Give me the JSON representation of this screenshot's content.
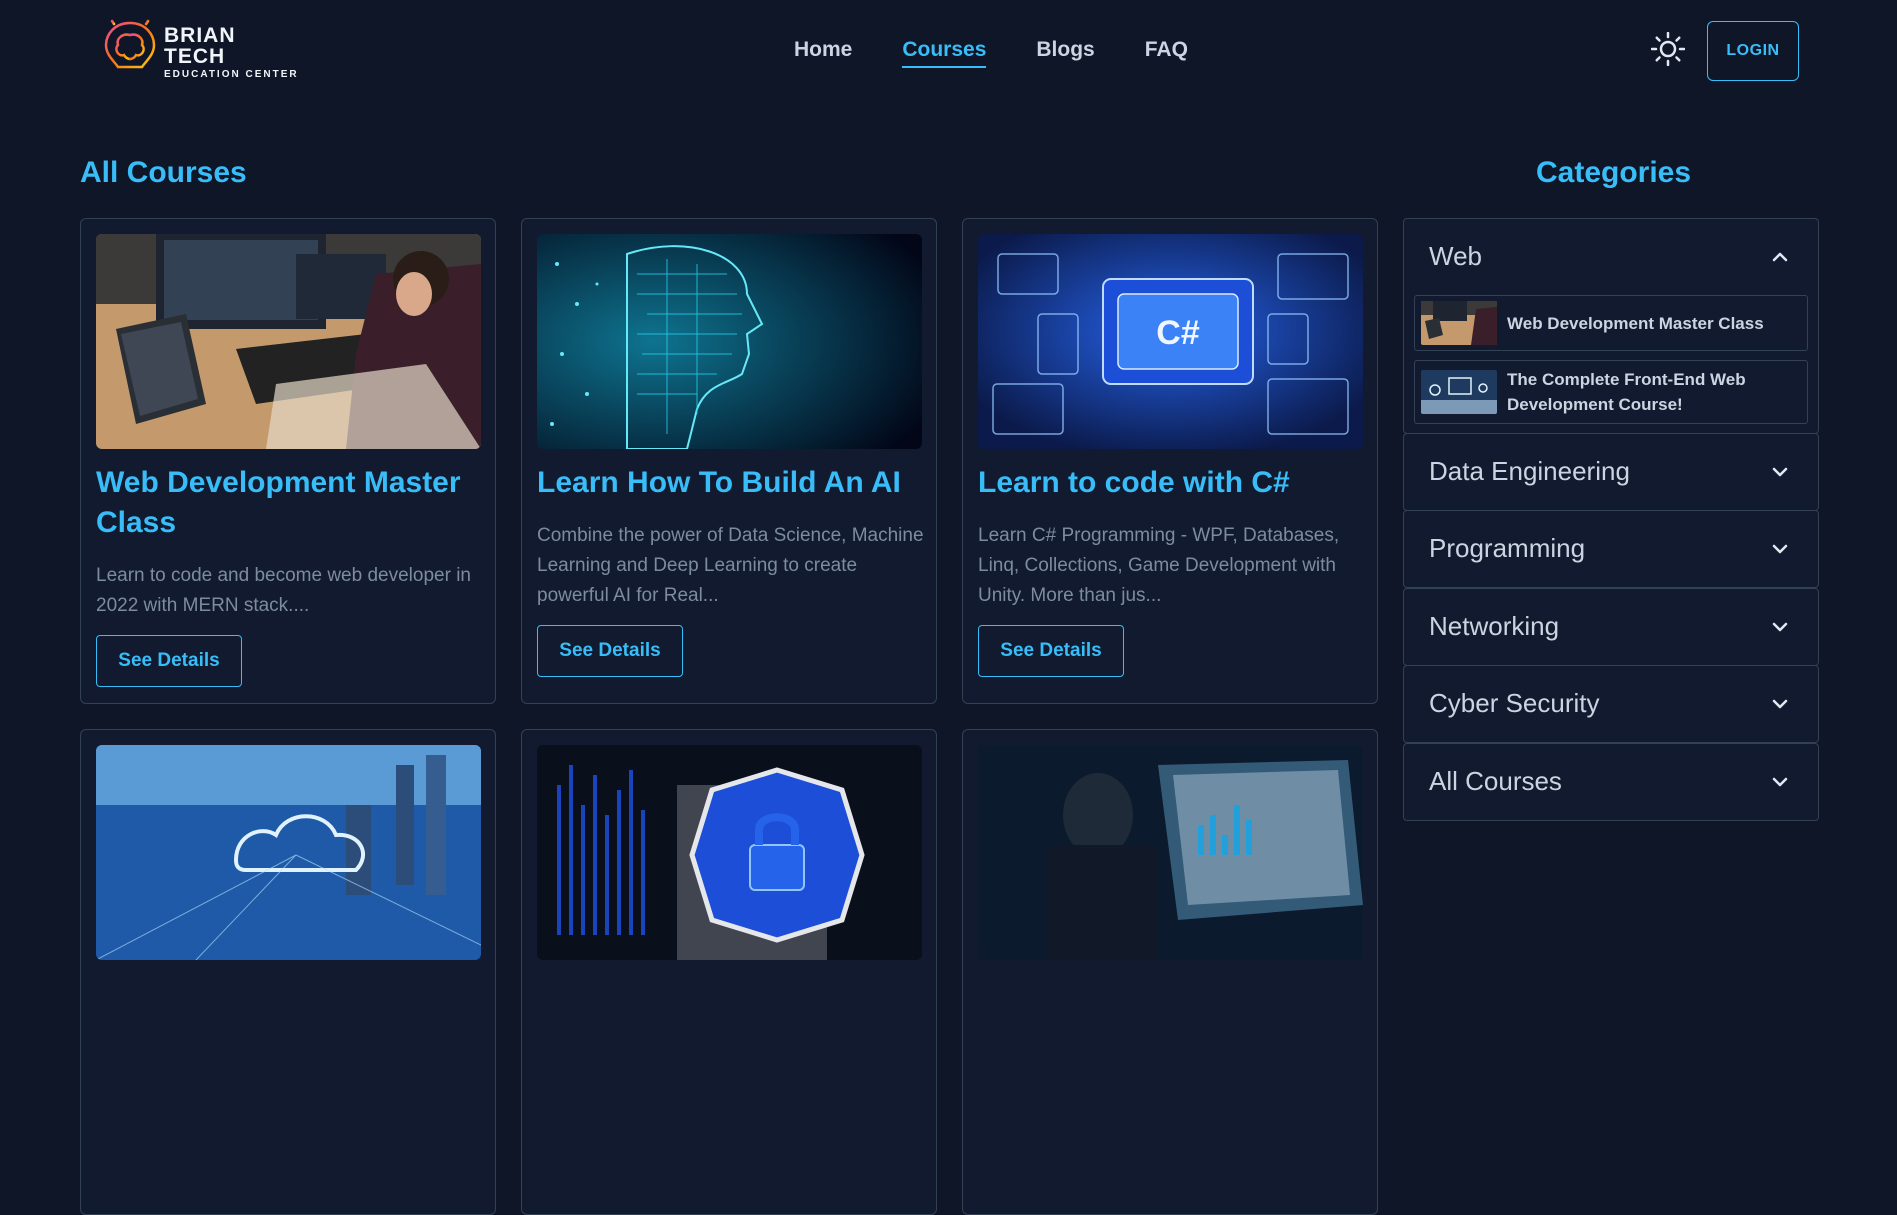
{
  "header": {
    "logo_title": "BRIAN TECH",
    "logo_subtitle": "EDUCATION CENTER",
    "nav": [
      {
        "label": "Home",
        "active": false
      },
      {
        "label": "Courses",
        "active": true
      },
      {
        "label": "Blogs",
        "active": false
      },
      {
        "label": "FAQ",
        "active": false
      }
    ],
    "theme_icon": "sun-icon",
    "login_label": "LOGIN"
  },
  "main": {
    "title": "All Courses",
    "courses": [
      {
        "title": "Web Development Master Class",
        "description": "Learn to code and become web developer in 2022 with MERN stack....",
        "button": "See Details",
        "image": "programmer-at-computers-photo"
      },
      {
        "title": "Learn How To Build An AI",
        "description": "Combine the power of Data Science, Machine Learning and Deep Learning to create powerful AI for Real...",
        "button": "See Details",
        "image": "circuit-head-photo"
      },
      {
        "title": "Learn to code with C#",
        "description": "Learn C# Programming - WPF, Databases, Linq, Collections, Game Development with Unity. More than jus...",
        "button": "See Details",
        "image": "csharp-circuit-photo"
      },
      {
        "image": "cloud-city-photo"
      },
      {
        "image": "security-lock-photo"
      },
      {
        "image": "data-screen-photo"
      }
    ]
  },
  "sidebar": {
    "title": "Categories",
    "categories": [
      {
        "label": "Web",
        "expanded": true,
        "chevron": "chevron-up-icon",
        "courses": [
          {
            "label": "Web Development Master Class"
          },
          {
            "label": "The Complete Front-End Web Development Course!"
          }
        ]
      },
      {
        "label": "Data Engineering",
        "expanded": false,
        "chevron": "chevron-down-icon"
      },
      {
        "label": "Programming",
        "expanded": false,
        "chevron": "chevron-down-icon"
      },
      {
        "label": "Networking",
        "expanded": false,
        "chevron": "chevron-down-icon"
      },
      {
        "label": "Cyber Security",
        "expanded": false,
        "chevron": "chevron-down-icon"
      },
      {
        "label": "All Courses",
        "expanded": false,
        "chevron": "chevron-down-icon"
      }
    ]
  },
  "colors": {
    "background": "#0f1628",
    "accent": "#38bdf8",
    "card_border": "#334155",
    "text": "#cbd5e1",
    "muted_text": "#7d8ba0"
  }
}
